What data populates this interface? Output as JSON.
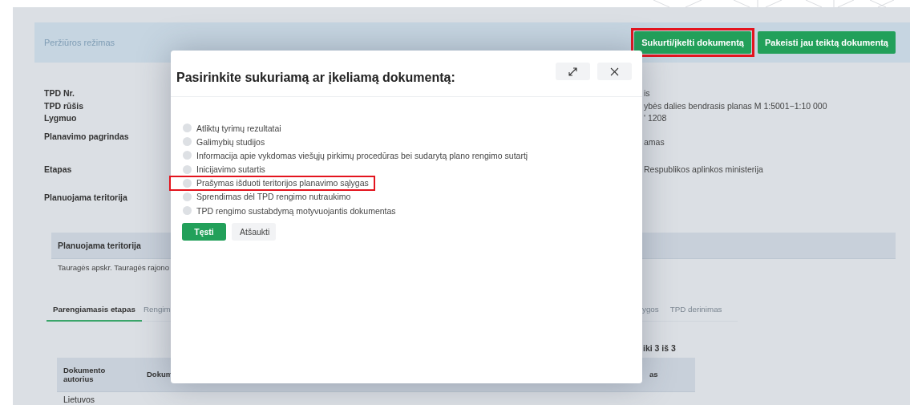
{
  "header": {
    "mode": "Peržiūros režimas",
    "buttons": [
      {
        "label": "Sukurti/įkelti dokumentą",
        "highlighted": true
      },
      {
        "label": "Pakeisti jau teiktą dokumentą",
        "highlighted": false
      }
    ]
  },
  "fields": [
    {
      "label": "TPD Nr.",
      "value": "is"
    },
    {
      "label": "TPD rūšis",
      "value": "ybės dalies bendrasis planas M 1:5001−1:10 000"
    },
    {
      "label": "Lygmuo",
      "value": "' 1208"
    },
    {
      "label": "Planavimo pagrindas",
      "value": "amas"
    },
    {
      "label": "Etapas",
      "value": "Respublikos aplinkos ministerija"
    },
    {
      "label": "Planuojama teritorija"
    }
  ],
  "territory_table": {
    "header": "Planuojama teritorija",
    "row": "Tauragės apskr. Tauragės rajono"
  },
  "tabs": [
    {
      "label": "Parengiamasis etapas",
      "selected": true
    },
    {
      "label": "Rengim",
      "selected": false
    },
    {
      "label": "ygos",
      "selected": false
    },
    {
      "label": "TPD derinimas",
      "selected": false
    }
  ],
  "pagination": "iki 3 iš 3",
  "documents_table": {
    "columns": [
      "Dokumento autorius",
      "Dokum",
      "as"
    ],
    "rows": [
      [
        "Lietuvos"
      ]
    ]
  },
  "modal": {
    "title": "Pasirinkite sukuriamą ar įkeliamą dokumentą:",
    "options": [
      {
        "label": "Atliktų tyrimų rezultatai",
        "selected": false,
        "highlighted": false
      },
      {
        "label": "Galimybių studijos",
        "selected": false,
        "highlighted": false
      },
      {
        "label": "Informacija apie vykdomas viešųjų pirkimų procedūras bei sudarytą plano rengimo sutartį",
        "selected": false,
        "highlighted": false
      },
      {
        "label": "Inicijavimo sutartis",
        "selected": false,
        "highlighted": false
      },
      {
        "label": "Prašymas išduoti teritorijos planavimo sąlygas",
        "selected": false,
        "highlighted": true
      },
      {
        "label": "Sprendimas dėl TPD rengimo nutraukimo",
        "selected": false,
        "highlighted": false
      },
      {
        "label": "TPD rengimo sustabdymą motyvuojantis dokumentas",
        "selected": false,
        "highlighted": false
      }
    ],
    "buttons": [
      {
        "label": "Tęsti",
        "kind": "primary"
      },
      {
        "label": "Atšaukti",
        "kind": "secondary"
      }
    ]
  }
}
